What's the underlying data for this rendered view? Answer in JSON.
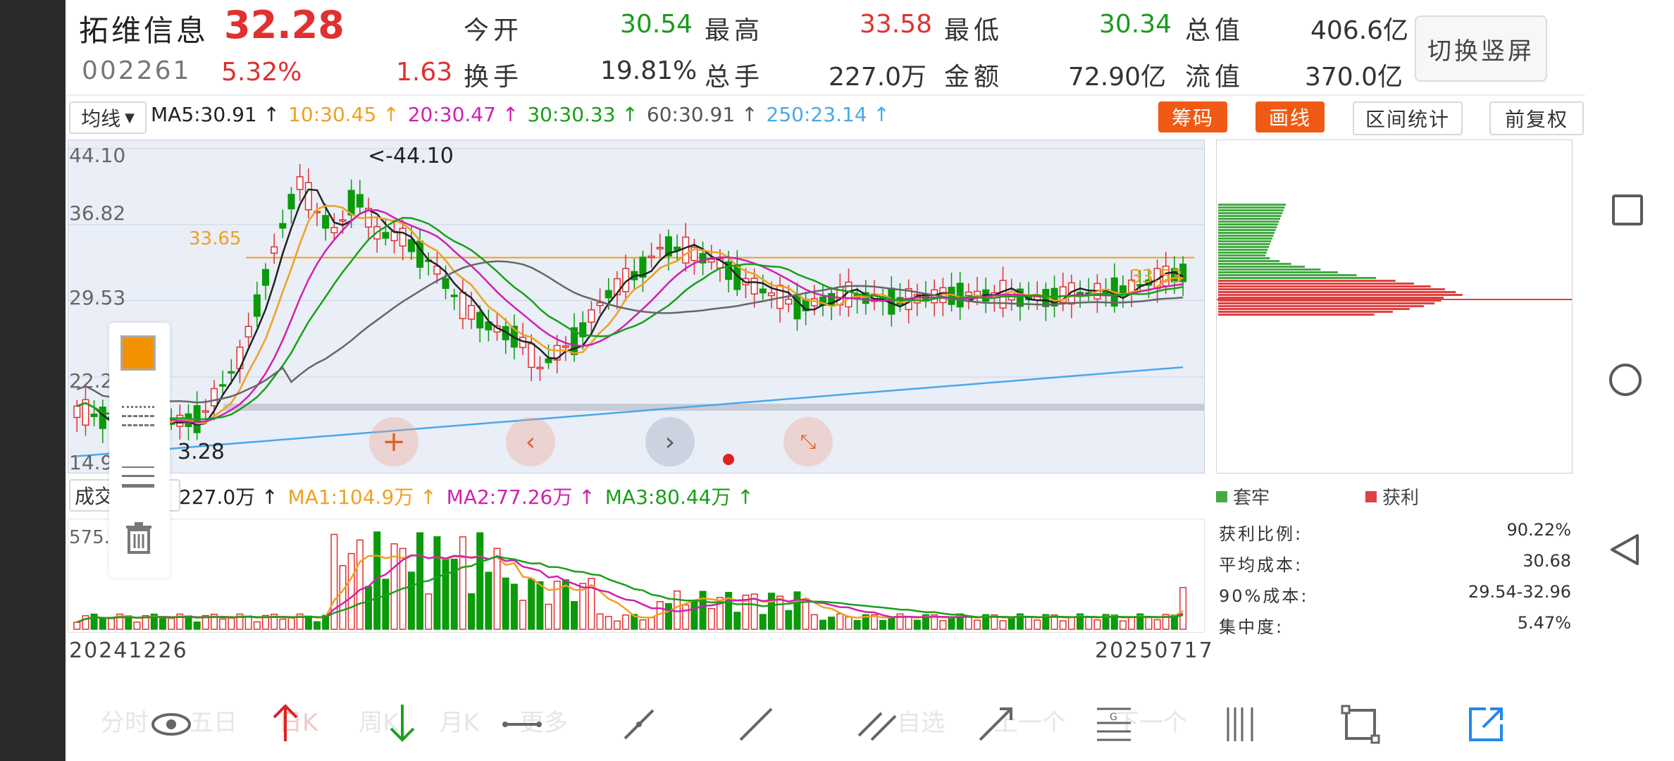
{
  "stock": {
    "name": "拓维信息",
    "price": "32.28",
    "code": "002261",
    "pct_change": "5.32%",
    "change": "1.63"
  },
  "quote": {
    "open_label": "今开",
    "open": "30.54",
    "high_label": "最高",
    "high": "33.58",
    "low_label": "最低",
    "low": "30.34",
    "mcap_label": "总值",
    "mcap": "406.6亿",
    "turnover_label": "换手",
    "turnover": "19.81%",
    "volume_label": "总手",
    "volume": "227.0万",
    "amount_label": "金额",
    "amount": "72.90亿",
    "float_label": "流值",
    "float_cap": "370.0亿"
  },
  "switch_button": "切换竖屏",
  "ma_bar": {
    "selector": "均线",
    "ma5": "MA5:30.91",
    "ma10": "10:30.45",
    "ma20": "20:30.47",
    "ma30": "30:30.33",
    "ma60": "60:30.91",
    "ma250": "250:23.14",
    "arrow": "↑"
  },
  "chips": {
    "chouma": "筹码",
    "huaxian": "画线",
    "qujian": "区间统计",
    "fuquan": "前复权"
  },
  "price_axis": {
    "ticks": [
      "44.10",
      "36.82",
      "29.53",
      "22.2",
      "14.9"
    ],
    "high_marker": "<-44.10",
    "low_marker": "3.28",
    "left_line_label": "33.65",
    "right_line_label": "33.53"
  },
  "volume_bar": {
    "selector": "成交量",
    "vol": "227.0万",
    "ma1": "MA1:104.9万",
    "ma2": "MA2:77.26万",
    "ma3": "MA3:80.44万",
    "arrow": "↑",
    "axis_max": "575."
  },
  "dates": {
    "start": "20241226",
    "end": "20250717"
  },
  "chip_legend": {
    "trapped": "套牢",
    "profit": "获利"
  },
  "chip_stats": [
    {
      "label": "获利比例:",
      "value": "90.22%"
    },
    {
      "label": "平均成本:",
      "value": "30.68"
    },
    {
      "label": "90%成本:",
      "value": "29.54-32.96"
    },
    {
      "label": "集中度:",
      "value": "5.47%"
    }
  ],
  "bottom_tabs_faded": [
    "分时",
    "五日",
    "日K",
    "周K",
    "月K",
    "更多",
    "自选",
    "上一个",
    "下一个"
  ],
  "colors": {
    "up": "#e03030",
    "down": "#0a9a0a",
    "ma5": "#222222",
    "ma10": "#f0a020",
    "ma20": "#d020b0",
    "ma30": "#18a018",
    "ma60": "#666666",
    "ma250": "#4aa8e8",
    "accent_orange": "#f05a14"
  },
  "chart_data": {
    "type": "candlestick",
    "x_range": [
      "20241226",
      "20250717"
    ],
    "price_ylim": [
      14.9,
      44.1
    ],
    "last_close": 32.28,
    "ma_last": {
      "ma5": 30.91,
      "ma10": 30.45,
      "ma20": 30.47,
      "ma30": 30.33,
      "ma60": 30.91,
      "ma250": 23.14
    },
    "chip_distribution": {
      "profit_ratio": 90.22,
      "avg_cost": 30.68,
      "cost_90": "29.54-32.96",
      "concentration": 5.47
    }
  }
}
